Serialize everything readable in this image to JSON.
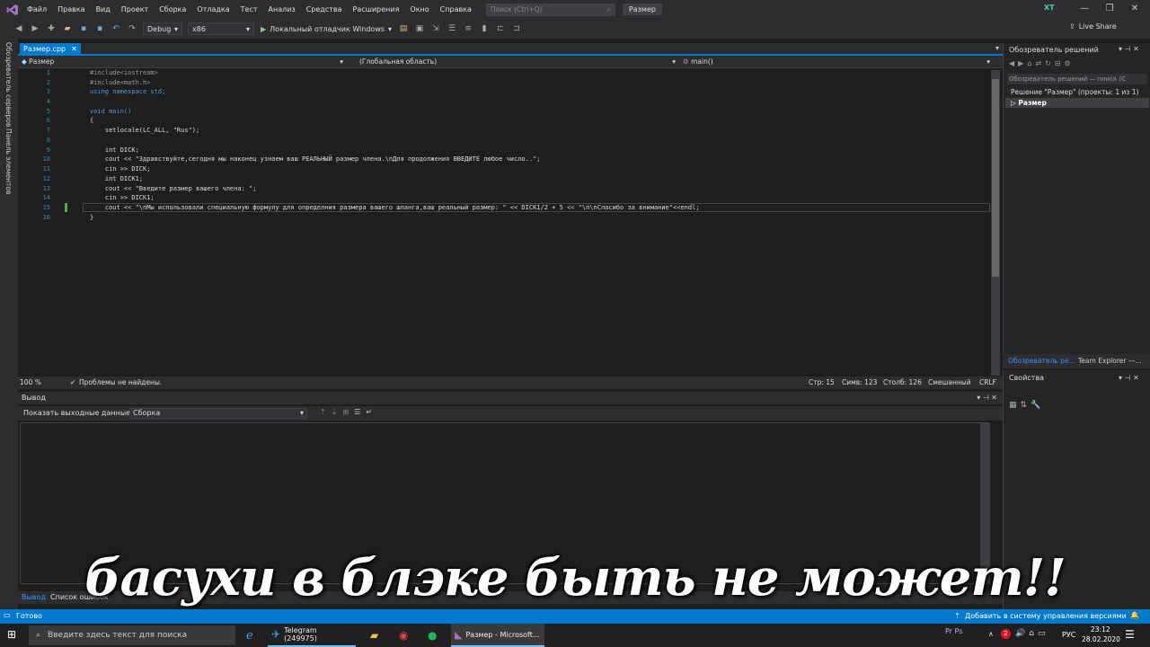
{
  "menu": {
    "items": [
      "Файл",
      "Правка",
      "Вид",
      "Проект",
      "Сборка",
      "Отладка",
      "Тест",
      "Анализ",
      "Средства",
      "Расширения",
      "Окно",
      "Справка"
    ],
    "search_placeholder": "Поиск (Ctrl+Q)",
    "window_title": "Размер",
    "user_initials": "XT"
  },
  "toolbar": {
    "config": "Debug",
    "platform": "x86",
    "run_label": "Локальный отладчик Windows",
    "live_share": "Live Share"
  },
  "left_tabs": [
    "Обозреватель серверов",
    "Панель элементов"
  ],
  "editor": {
    "tab_label": "Размер.cpp",
    "nav_project": "Размер",
    "nav_scope": "(Глобальная область)",
    "nav_member": "main()",
    "lines": [
      {
        "n": "1",
        "text": "#include<iostream>"
      },
      {
        "n": "2",
        "text": "#include<math.h>"
      },
      {
        "n": "3",
        "text": "using namespace std;"
      },
      {
        "n": "4",
        "text": ""
      },
      {
        "n": "5",
        "text": "void main()"
      },
      {
        "n": "6",
        "text": "{"
      },
      {
        "n": "7",
        "text": "    setlocale(LC_ALL, \"Rus\");"
      },
      {
        "n": "8",
        "text": ""
      },
      {
        "n": "9",
        "text": "    int DICK;"
      },
      {
        "n": "10",
        "text": "    cout << \"Здравствуйте,сегодня мы наконец узнаем ваш РЕАЛЬНЫЙ размер члена.\\nДля продолжения ВВЕДИТЕ любое число..\";"
      },
      {
        "n": "11",
        "text": "    cin >> DICK;"
      },
      {
        "n": "12",
        "text": "    int DICK1;"
      },
      {
        "n": "13",
        "text": "    cout << \"Введите размер вашего члена: \";"
      },
      {
        "n": "14",
        "text": "    cin >> DICK1;"
      },
      {
        "n": "15",
        "text": "    cout << \"\\nМы использовали специальную формулу для определния размера вашего шланга,ваш реальный размер: \" << DICK1/2 + 5 << \"\\n\\nСпасибо за внимание\"<<endl;"
      },
      {
        "n": "16",
        "text": "}"
      }
    ]
  },
  "editor_status": {
    "zoom": "100 %",
    "problems": "Проблемы не найдены.",
    "line": "Стр: 15",
    "char": "Симв: 123",
    "col": "Столб: 126",
    "mode": "Смешанный",
    "eol": "CRLF"
  },
  "solution_explorer": {
    "title": "Обозреватель решений",
    "search": "Обозреватель решений — поиск (C",
    "root": "Решение \"Размер\" (проекты: 1 из 1)",
    "project": "Размер",
    "tab1": "Обозреватель ре...",
    "tab2": "Team Explorer —..."
  },
  "properties": {
    "title": "Свойства"
  },
  "output": {
    "title": "Вывод",
    "show_label": "Показать выходные данные из:",
    "source": "Сборка",
    "tab_output": "Вывод",
    "tab_errors": "Список ошибок"
  },
  "statusbar": {
    "ready": "Готово",
    "vcs": "Добавить в систему управления версиями"
  },
  "taskbar": {
    "search": "Введите здесь текст для поиска",
    "telegram": "Telegram (249975)",
    "vs": "Размер - Microsoft...",
    "lang": "РУС",
    "time": "23:12",
    "date": "28.02.2020",
    "badge": "2"
  },
  "caption": "басухи в блэке быть не может!!",
  "colors": {
    "accent": "#007acc",
    "background": "#1e1e1e",
    "chrome": "#2d2d30"
  }
}
